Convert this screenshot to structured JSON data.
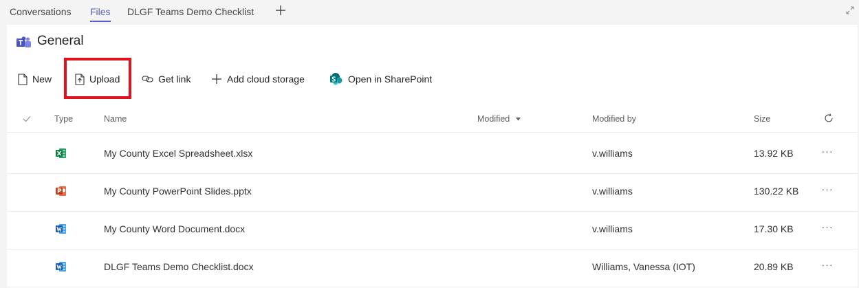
{
  "tabs": [
    {
      "label": "Conversations",
      "active": false
    },
    {
      "label": "Files",
      "active": true
    },
    {
      "label": "DLGF Teams Demo Checklist",
      "active": false
    }
  ],
  "channel": {
    "title": "General"
  },
  "toolbar": {
    "new_label": "New",
    "upload_label": "Upload",
    "get_link_label": "Get link",
    "add_cloud_storage_label": "Add cloud storage",
    "open_sharepoint_label": "Open in SharePoint"
  },
  "table": {
    "headers": {
      "type": "Type",
      "name": "Name",
      "modified": "Modified",
      "modified_by": "Modified by",
      "size": "Size"
    },
    "rows": [
      {
        "file_type": "excel",
        "name": "My County Excel Spreadsheet.xlsx",
        "modified_by": "v.williams",
        "size": "13.92 KB"
      },
      {
        "file_type": "powerpoint",
        "name": "My County PowerPoint Slides.pptx",
        "modified_by": "v.williams",
        "size": "130.22 KB"
      },
      {
        "file_type": "word",
        "name": "My County Word Document.docx",
        "modified_by": "v.williams",
        "size": "17.30 KB"
      },
      {
        "file_type": "word",
        "name": "DLGF Teams Demo Checklist.docx",
        "modified_by": "Williams, Vanessa (IOT)",
        "size": "20.89 KB"
      }
    ],
    "more_label": "···"
  },
  "colors": {
    "accent": "#5b5fc7",
    "highlight": "#e1141e",
    "excel": "#1e7145",
    "powerpoint": "#d04423",
    "word": "#2b579a",
    "sharepoint": "#038387"
  },
  "icons": [
    "plus-icon",
    "expand-icon",
    "teams-logo-icon",
    "new-document-icon",
    "upload-icon",
    "link-icon",
    "sharepoint-icon",
    "checkmark-icon",
    "sort-down-icon",
    "refresh-icon",
    "excel-file-icon",
    "powerpoint-file-icon",
    "word-file-icon",
    "more-options-icon"
  ]
}
